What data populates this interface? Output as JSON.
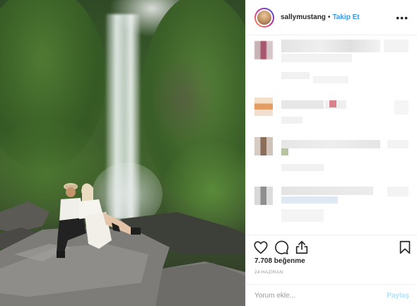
{
  "header": {
    "username": "sallymustang",
    "separator": "•",
    "follow_label": "Takip Et",
    "more_label": "•••"
  },
  "photo": {
    "description_icon": "waterfall-photo"
  },
  "actions": {
    "like_icon": "heart-icon",
    "comment_icon": "comment-icon",
    "share_icon": "share-icon",
    "save_icon": "bookmark-icon"
  },
  "likes": {
    "text": "7.708 beğenme"
  },
  "date": {
    "text": "24 HAZİRAN"
  },
  "comment_box": {
    "placeholder": "Yorum ekle...",
    "post_label": "Paylaş"
  },
  "colors": {
    "accent": "#3897f0",
    "post_disabled": "#b2dffc",
    "text": "#262626",
    "muted": "#999999"
  }
}
